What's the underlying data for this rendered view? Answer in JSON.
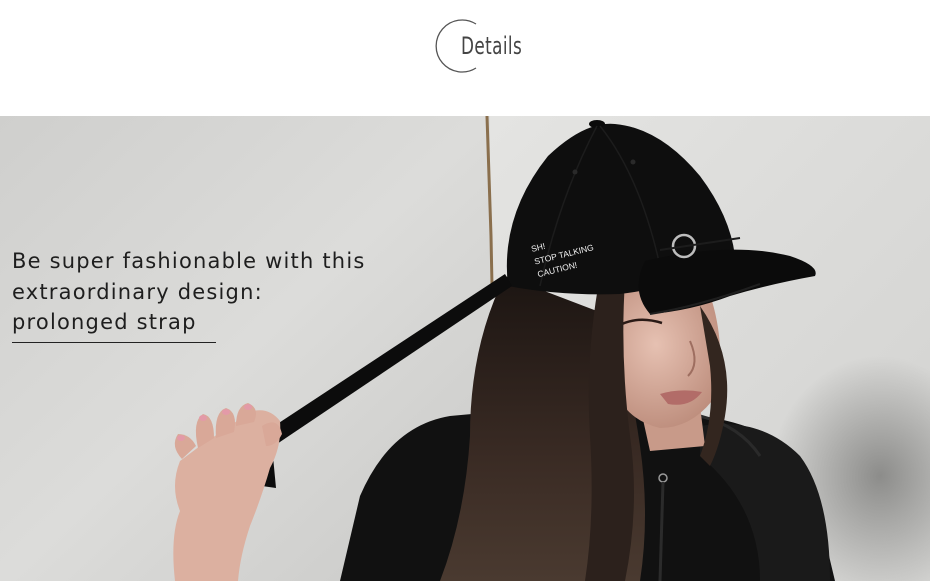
{
  "header": {
    "title": "Details"
  },
  "caption": {
    "lines": [
      "Be super fashionable with this",
      "extraordinary design:",
      "prolonged strap"
    ]
  },
  "cap": {
    "embroidery_lines": [
      "SH!",
      "STOP TALKING",
      "CAUTION!"
    ]
  },
  "colors": {
    "background": "#ffffff",
    "wall": "#d9d9d7",
    "cap": "#0e0e0e",
    "hair": "#2a1f1a",
    "skin": "#d8ab9a",
    "hoodie": "#111111",
    "title_text": "#444444",
    "caption_text": "#1e1e1e"
  },
  "icons": {
    "title_decoration": "arc-circle-icon"
  }
}
